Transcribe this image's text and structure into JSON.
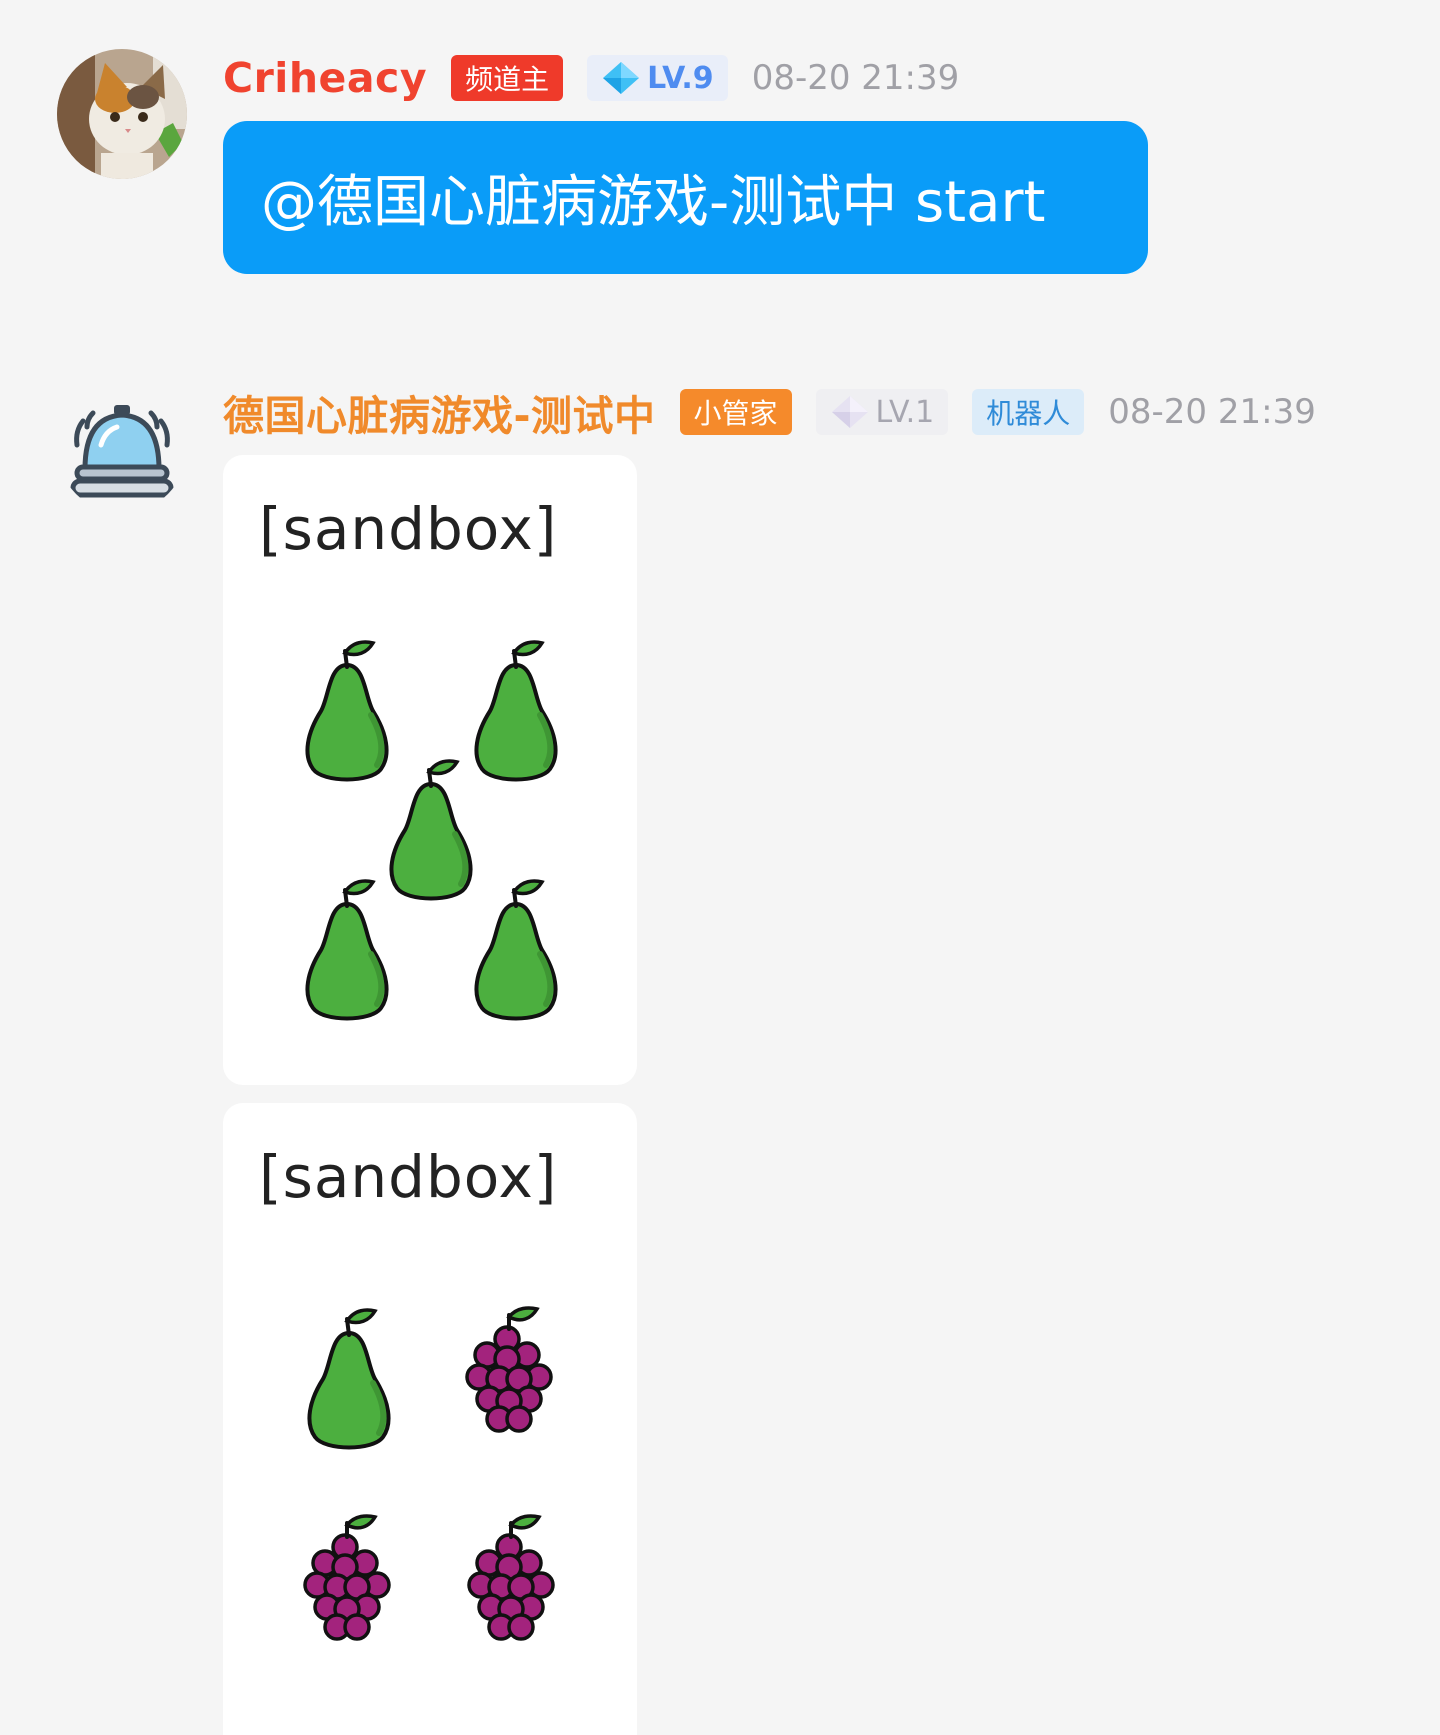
{
  "messages": [
    {
      "sender": "Criheacy",
      "role_badge": "频道主",
      "level_badge": "LV.9",
      "time": "08-20 21:39",
      "text": "@德国心脏病游戏-测试中 start",
      "avatar": "cat-photo"
    },
    {
      "sender": "德国心脏病游戏-测试中",
      "role_badge": "小管家",
      "level_badge": "LV.1",
      "type_badge": "机器人",
      "time": "08-20 21:39",
      "avatar": "service-bell-icon",
      "cards": [
        {
          "title": "[sandbox]",
          "fruits": [
            "pear",
            "pear",
            "pear",
            "pear",
            "pear"
          ]
        },
        {
          "title": "[sandbox]",
          "fruits": [
            "pear",
            "grape",
            "grape",
            "grape"
          ]
        }
      ]
    }
  ],
  "colors": {
    "background": "#f5f5f5",
    "user_bubble": "#0a9cf8",
    "owner_name": "#f0432f",
    "bot_name": "#f08a2b",
    "pear_fill": "#4caf3f",
    "grape_fill": "#a3237d"
  }
}
